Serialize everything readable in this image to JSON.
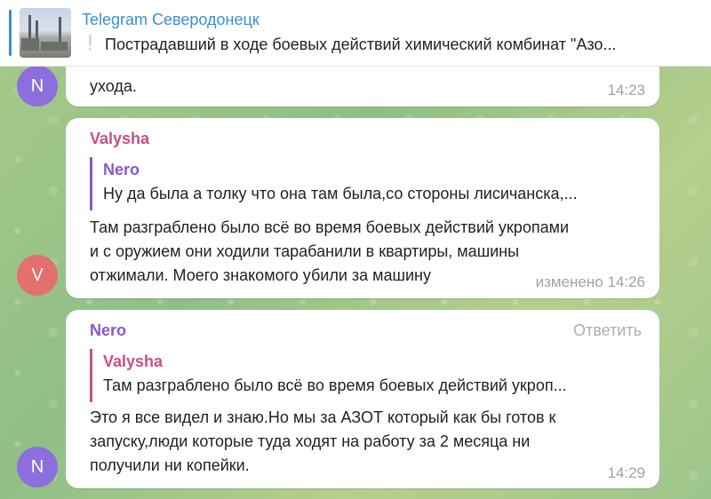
{
  "pinned": {
    "channel_title": "Telegram Северодонецк",
    "text": "Пострадавший в ходе боевых действий химический комбинат \"Азо..."
  },
  "messages": [
    {
      "avatar_letter": "N",
      "avatar_color": "#8c6fdc",
      "body_lines": [
        "ухода."
      ],
      "time": "14:23"
    },
    {
      "avatar_letter": "V",
      "avatar_color": "#e2706f",
      "sender": "Valysha",
      "sender_color": "#cc4d86",
      "reply": {
        "name": "Nero",
        "name_color": "#8a58c9",
        "text": "Ну да была а толку что она там была,со стороны лисичанска,..."
      },
      "body_lines": [
        "Там разграблено было всё во время боевых действий укропами",
        "и с оружием они ходили тарабанили в квартиры, машины",
        "отжимали. Моего знакомого убили за машину"
      ],
      "time": "изменено 14:26"
    },
    {
      "avatar_letter": "N",
      "avatar_color": "#8c6fdc",
      "sender": "Nero",
      "sender_color": "#8a58c9",
      "reply_button": "Ответить",
      "reply": {
        "name": "Valysha",
        "name_color": "#cc4d86",
        "text": "Там разграблено было всё во время боевых действий укроп..."
      },
      "body_lines": [
        "Это я все видел и знаю.Но мы за АЗОТ который как бы готов к",
        "запуску,люди которые туда ходят на работу за 2 месяца ни",
        "получили ни копейки."
      ],
      "time": "14:29"
    }
  ]
}
